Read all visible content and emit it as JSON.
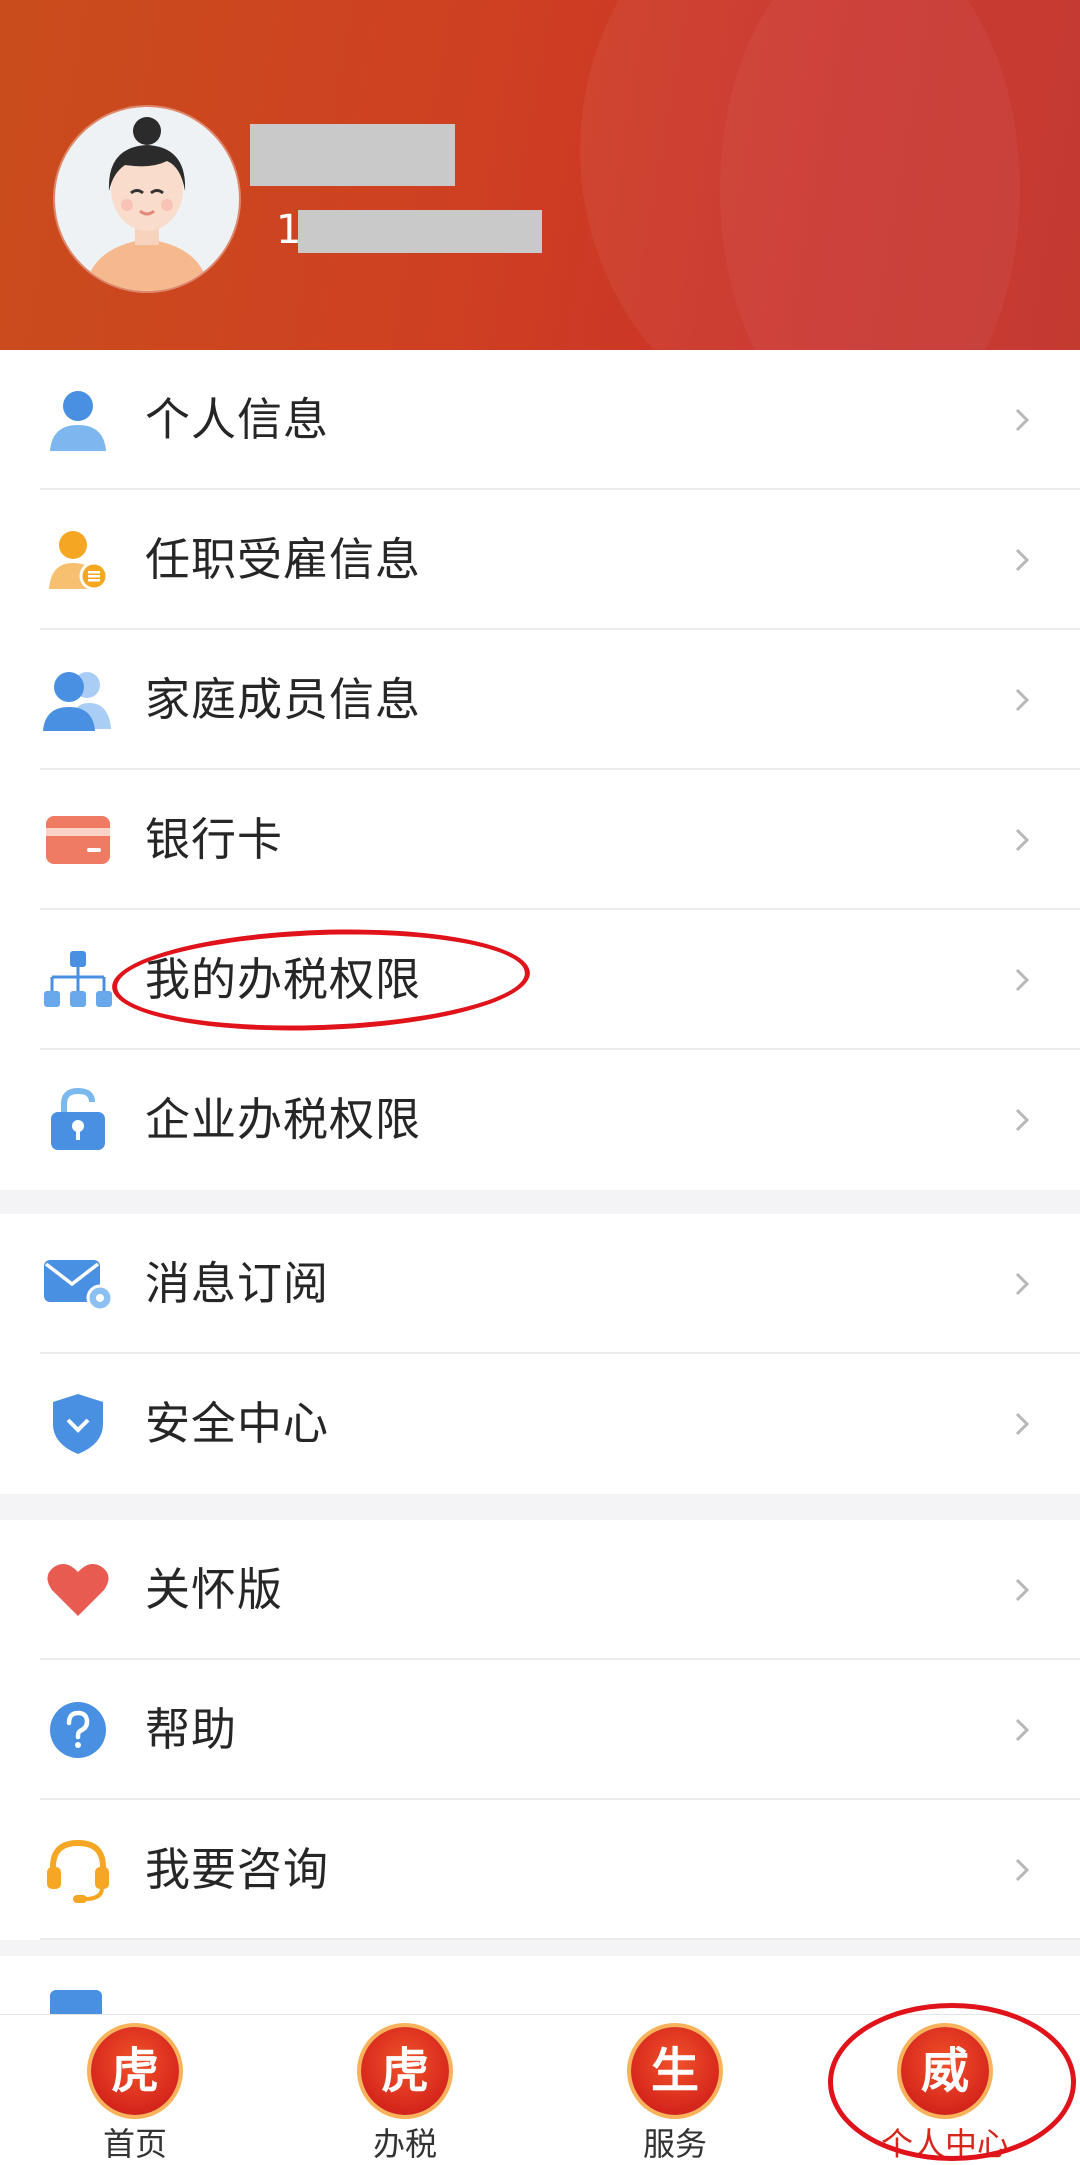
{
  "profile": {
    "name": "",
    "phone_prefix": "1"
  },
  "group1": [
    {
      "label": "个人信息",
      "icon": "person-icon"
    },
    {
      "label": "任职受雇信息",
      "icon": "employee-card-icon"
    },
    {
      "label": "家庭成员信息",
      "icon": "family-icon"
    },
    {
      "label": "银行卡",
      "icon": "bank-card-icon"
    },
    {
      "label": "我的办税权限",
      "icon": "org-tree-icon"
    },
    {
      "label": "企业办税权限",
      "icon": "unlock-icon"
    }
  ],
  "group2": [
    {
      "label": "消息订阅",
      "icon": "mail-settings-icon"
    },
    {
      "label": "安全中心",
      "icon": "shield-icon"
    }
  ],
  "group3": [
    {
      "label": "关怀版",
      "icon": "heart-icon"
    },
    {
      "label": "帮助",
      "icon": "help-icon"
    },
    {
      "label": "我要咨询",
      "icon": "headset-icon"
    }
  ],
  "tabbar": [
    {
      "label": "首页",
      "badge": "虎"
    },
    {
      "label": "办税",
      "badge": "虎"
    },
    {
      "label": "服务",
      "badge": "生"
    },
    {
      "label": "个人中心",
      "badge": "威",
      "active": true
    }
  ],
  "colors": {
    "brand_red": "#d6261c",
    "annotation_red": "#e0121a",
    "icon_blue": "#4a90e2",
    "icon_orange": "#f5a623"
  }
}
